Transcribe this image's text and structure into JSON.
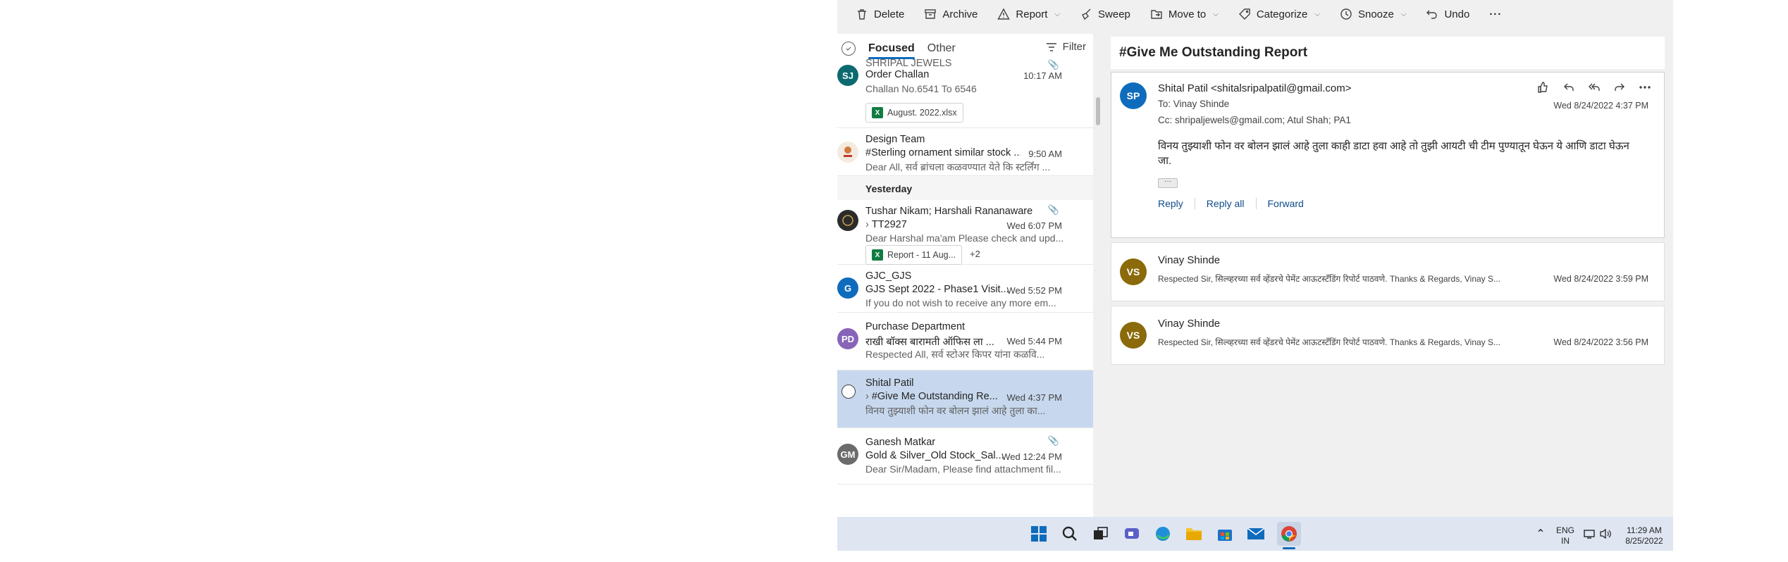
{
  "toolbar": {
    "delete": "Delete",
    "archive": "Archive",
    "report": "Report",
    "sweep": "Sweep",
    "move_to": "Move to",
    "categorize": "Categorize",
    "snooze": "Snooze",
    "undo": "Undo",
    "more": "···"
  },
  "list": {
    "tabs": [
      "Focused",
      "Other"
    ],
    "filter": "Filter",
    "section_yesterday": "Yesterday",
    "items": [
      {
        "initials": "SJ",
        "avatar_color": "#0b6a6f",
        "sender": "SHRIPAL JEWELS",
        "subject": "Order Challan",
        "time": "10:17 AM",
        "preview": "Challan No.6541 To 6546",
        "attachment": "August. 2022.xlsx"
      },
      {
        "initials": "",
        "avatar_color": "#e8d9c8",
        "sender": "Design Team",
        "subject": "#Sterling ornament similar stock ...",
        "time": "9:50 AM",
        "preview": "Dear All, सर्व ब्रांचला कळवण्यात येते कि स्टर्लिंग ..."
      },
      {
        "initials": "",
        "avatar_color": "#3b3b3b",
        "sender": "Tushar Nikam; Harshali Rananaware",
        "subject": "TT2927",
        "time": "Wed 6:07 PM",
        "preview": "Dear Harshal ma'am Please check and upd...",
        "attachment": "Report - 11 Aug...",
        "extra": "+2"
      },
      {
        "initials": "G",
        "avatar_color": "#0f6cbd",
        "sender": "GJC_GJS",
        "subject": "GJS Sept 2022 - Phase1 Visit...",
        "time": "Wed 5:52 PM",
        "preview": "If you do not wish to receive any more em..."
      },
      {
        "initials": "PD",
        "avatar_color": "#8764b8",
        "sender": "Purchase Department",
        "subject": "राखी बॉक्स बारामती ऑफिस ला ...",
        "time": "Wed 5:44 PM",
        "preview": "Respected All, सर्व स्टोअर किपर यांना कळवि..."
      },
      {
        "initials": "",
        "avatar_color": "",
        "sender": "Shital Patil",
        "subject": "#Give Me Outstanding Re...",
        "time": "Wed 4:37 PM",
        "preview": "विनय तुझ्याशी फोन वर बोलन झालं आहे तुला का..."
      },
      {
        "initials": "GM",
        "avatar_color": "#6b6b6b",
        "sender": "Ganesh Matkar",
        "subject": "Gold & Silver_Old Stock_Sal...",
        "time": "Wed 12:24 PM",
        "preview": "Dear Sir/Madam, Please find attachment fil..."
      }
    ]
  },
  "reading": {
    "subject": "#Give Me Outstanding Report",
    "main": {
      "initials": "SP",
      "avatar_color": "#0f6cbd",
      "sender": "Shital Patil <shitalsripalpatil@gmail.com>",
      "to_label": "To:",
      "to": "Vinay Shinde",
      "cc_label": "Cc:",
      "cc": "shripaljewels@gmail.com;  Atul Shah;  PA1",
      "time": "Wed 8/24/2022 4:37 PM",
      "body": "विनय तुझ्याशी फोन वर बोलन झालं आहे तुला काही डाटा हवा आहे तो तुझी आयटी ची टीम पुण्यातून घेऊन ये आणि डाटा घेऊन जा.",
      "ellipsis": "···",
      "reply": "Reply",
      "reply_all": "Reply all",
      "forward": "Forward"
    },
    "collapsed": [
      {
        "initials": "VS",
        "avatar_color": "#8a6a0a",
        "sender": "Vinay Shinde",
        "preview": "Respected Sir, सिल्व्हरच्या सर्व व्हेंडरचे पेमेंट आऊटस्टँडिंग रिपोर्ट पाठवणे. Thanks & Regards, Vinay S...",
        "time": "Wed 8/24/2022 3:59 PM"
      },
      {
        "initials": "VS",
        "avatar_color": "#8a6a0a",
        "sender": "Vinay Shinde",
        "preview": "Respected Sir, सिल्व्हरच्या सर्व व्हेंडरचे पेमेंट आऊटस्टँडिंग रिपोर्ट पाठवणे. Thanks & Regards, Vinay S...",
        "time": "Wed 8/24/2022 3:56 PM"
      }
    ]
  },
  "taskbar": {
    "lang_top": "ENG",
    "lang_bottom": "IN",
    "clock_time": "11:29 AM",
    "clock_date": "8/25/2022"
  }
}
